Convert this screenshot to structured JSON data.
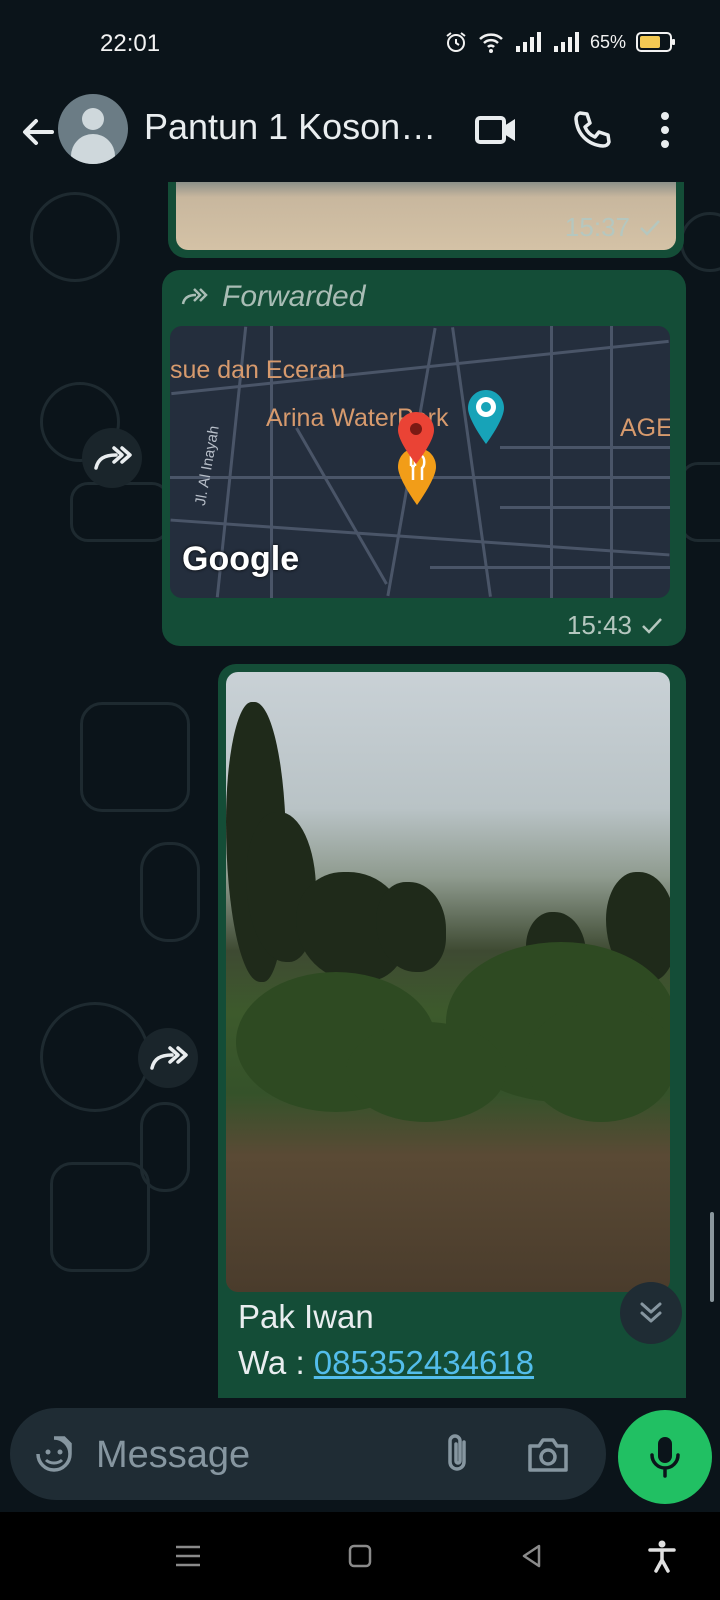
{
  "status_bar": {
    "time": "22:01",
    "battery": "65%",
    "icons": [
      "alarm-icon",
      "wifi-icon",
      "signal-icon",
      "signal-icon",
      "battery-icon"
    ]
  },
  "header": {
    "title": "Pantun 1 Koson…",
    "icons": [
      "back-arrow-icon",
      "avatar",
      "video-call-icon",
      "phone-icon",
      "more-vert-icon"
    ]
  },
  "messages": [
    {
      "type": "image",
      "time": "15:37",
      "status": "sent"
    },
    {
      "type": "location",
      "forwarded_label": "Forwarded",
      "map_labels": {
        "place1": "sue dan Eceran",
        "place2": "Arina WaterPark",
        "place3": "AGE",
        "street": "Jl. Al Inayah",
        "logo": "Google"
      },
      "time": "15:43",
      "status": "sent"
    },
    {
      "type": "image",
      "caption_line1": "Pak Iwan",
      "caption_wa_prefix": "Wa : ",
      "caption_phone": "085352434618"
    }
  ],
  "input": {
    "placeholder": "Message"
  },
  "colors": {
    "background": "#0b141a",
    "outgoing_bubble": "#144d37",
    "accent_green": "#21c063",
    "link": "#53bdeb"
  }
}
